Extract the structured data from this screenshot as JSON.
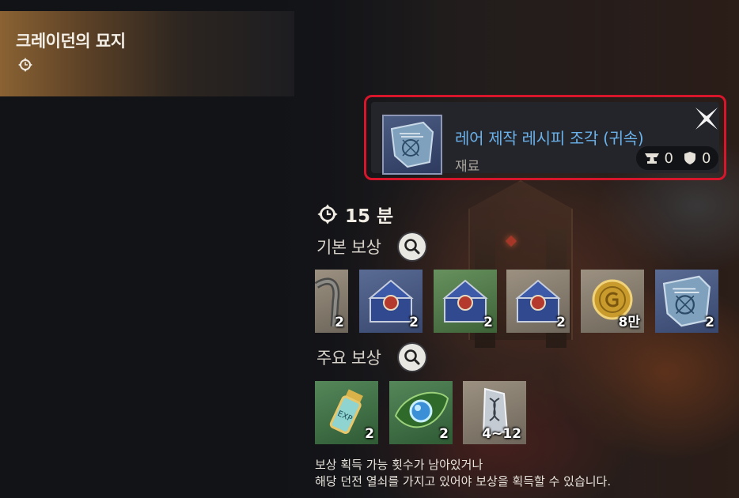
{
  "dungeon": {
    "title": "크레이던의 묘지"
  },
  "tooltip": {
    "item_name": "레어 제작 레시피 조각 (귀속)",
    "item_type": "재료",
    "stat_anvil": "0",
    "stat_shield": "0",
    "name_color": "#6bb1ea",
    "highlight_color": "#d7152b"
  },
  "time": {
    "label": "15 분"
  },
  "basic_rewards": {
    "label": "기본 보상",
    "items": [
      {
        "icon": "material-strap-icon",
        "count": "2"
      },
      {
        "icon": "blue-treasure-chest-icon",
        "count": "2"
      },
      {
        "icon": "green-treasure-chest-icon",
        "count": "2"
      },
      {
        "icon": "grey-treasure-chest-icon",
        "count": "2"
      },
      {
        "icon": "gold-coin-icon",
        "count": "8만"
      },
      {
        "icon": "recipe-fragment-icon",
        "count": "2"
      }
    ]
  },
  "main_rewards": {
    "label": "주요 보상",
    "items": [
      {
        "icon": "exp-vial-icon",
        "count": "2"
      },
      {
        "icon": "leaf-gem-icon",
        "count": "2"
      },
      {
        "icon": "dna-crystal-icon",
        "count": "4~12"
      }
    ]
  },
  "footer": {
    "line1": "보상 획득 가능 횟수가 남아있거나",
    "line2": "해당 던전 열쇠를 가지고 있어야 보상을 획득할 수 있습니다."
  }
}
